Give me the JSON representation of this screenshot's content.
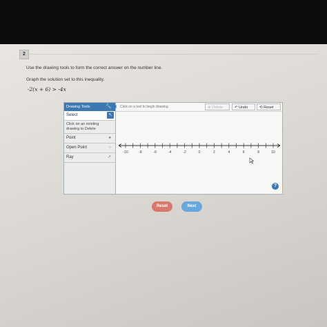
{
  "question": {
    "number": "2",
    "instruction": "Use the drawing tools to form the correct answer on the number line.",
    "prompt": "Graph the solution set to this inequality.",
    "inequality": "-2(x + 6) > -4x"
  },
  "tools": {
    "header": "Drawing Tools",
    "select": "Select",
    "delete_hint_line1": "Click on an existing",
    "delete_hint_line2": "drawing to Delete",
    "point": "Point",
    "open_point": "Open Point",
    "ray": "Ray"
  },
  "canvas": {
    "hint": "Click on a tool to begin drawing.",
    "delete": "Delete",
    "undo": "Undo",
    "reset": "Reset",
    "help": "?"
  },
  "number_line": {
    "min": -10,
    "max": 10,
    "labels": [
      "-10",
      "-8",
      "-6",
      "-4",
      "-2",
      "0",
      "2",
      "4",
      "6",
      "8",
      "10"
    ]
  },
  "footer": {
    "reset": "Reset",
    "next": "Next"
  }
}
